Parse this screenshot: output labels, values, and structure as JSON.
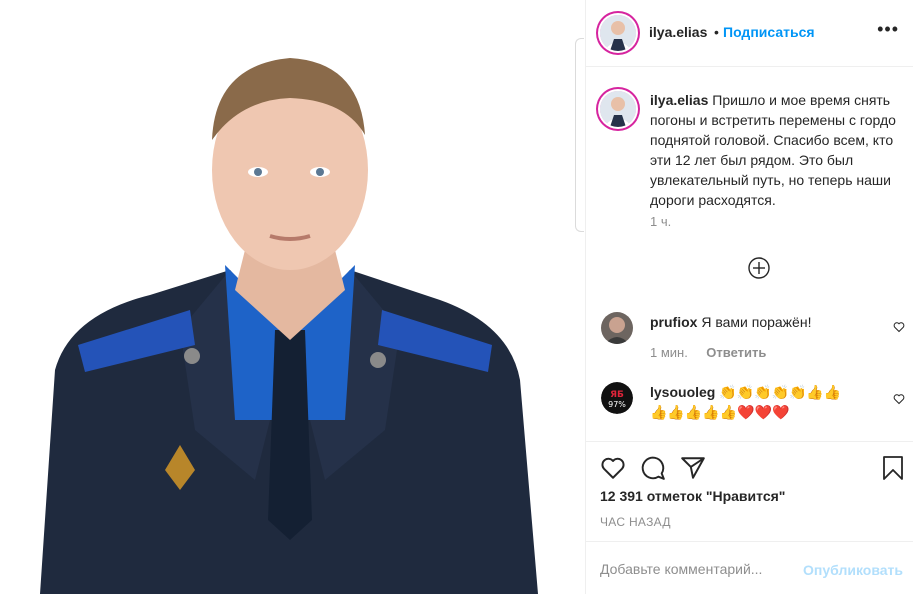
{
  "post": {
    "username": "ilya.elias",
    "follow_label": "Подписаться",
    "more_label": "•••",
    "caption": "Пришло и мое время снять погоны и встретить перемены с гордо поднятой головой. Спасибо всем, кто эти 12 лет был рядом. Это был увлекательный путь, но теперь наши дороги расходятся.",
    "caption_time": "1 ч.",
    "likes": "12 391 отметок \"Нравится\"",
    "posted_ago": "ЧАС НАЗАД",
    "comment_placeholder": "Добавьте комментарий...",
    "publish_label": "Опубликовать"
  },
  "comments": [
    {
      "username": "prufiox",
      "text": "Я вами поражён!",
      "time": "1 мин.",
      "reply_label": "Ответить"
    },
    {
      "username": "lysouoleg",
      "text_line1": "👏👏👏👏👏👍👍",
      "text_line2": "👍👍👍👍👍❤️❤️❤️"
    }
  ],
  "icons": {
    "expand": "plus-circle-icon",
    "like": "heart-icon",
    "comment": "comment-bubble-icon",
    "share": "paper-plane-icon",
    "save": "bookmark-icon"
  },
  "colors": {
    "accent": "#0095f6",
    "publish_disabled": "#b2dffc",
    "muted": "#8e8e8e",
    "story_ring": "#d6249f"
  }
}
